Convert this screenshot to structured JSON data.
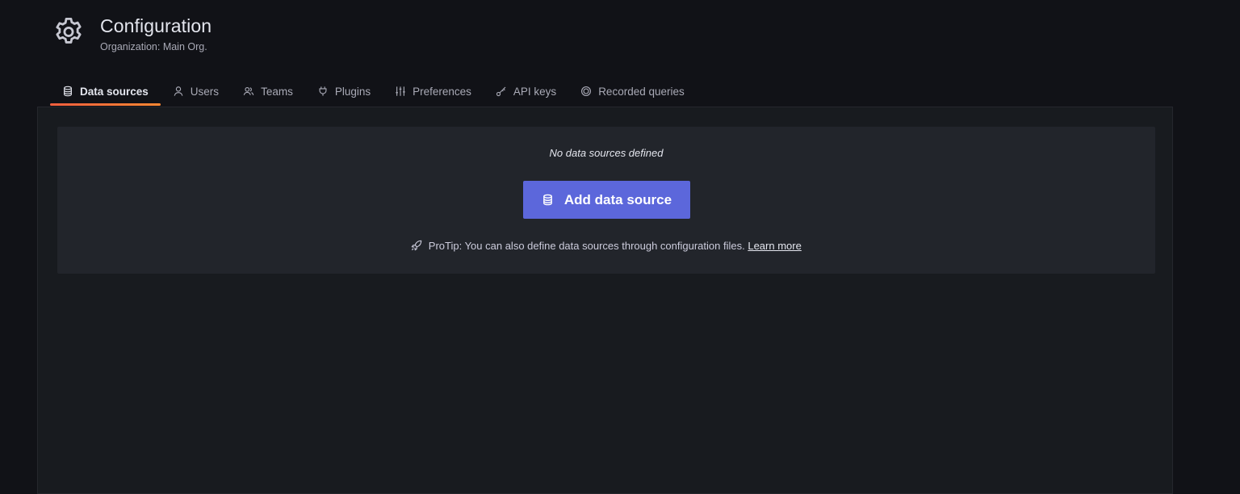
{
  "header": {
    "title": "Configuration",
    "subtitle": "Organization: Main Org.",
    "icon": "cog-icon"
  },
  "tabs": [
    {
      "label": "Data sources",
      "icon": "database-icon",
      "active": true
    },
    {
      "label": "Users",
      "icon": "user-icon",
      "active": false
    },
    {
      "label": "Teams",
      "icon": "users-icon",
      "active": false
    },
    {
      "label": "Plugins",
      "icon": "plug-icon",
      "active": false
    },
    {
      "label": "Preferences",
      "icon": "sliders-icon",
      "active": false
    },
    {
      "label": "API keys",
      "icon": "key-icon",
      "active": false
    },
    {
      "label": "Recorded queries",
      "icon": "record-icon",
      "active": false
    }
  ],
  "empty_state": {
    "message": "No data sources defined",
    "button_label": "Add data source",
    "button_icon": "database-icon",
    "protip_text": "ProTip: You can also define data sources through configuration files.",
    "protip_icon": "rocket-icon",
    "learn_more": "Learn more"
  },
  "colors": {
    "background": "#111217",
    "panel": "#181b1f",
    "card": "#22252b",
    "primary_button": "#5c67db",
    "active_tab_underline": "#ff8833"
  }
}
